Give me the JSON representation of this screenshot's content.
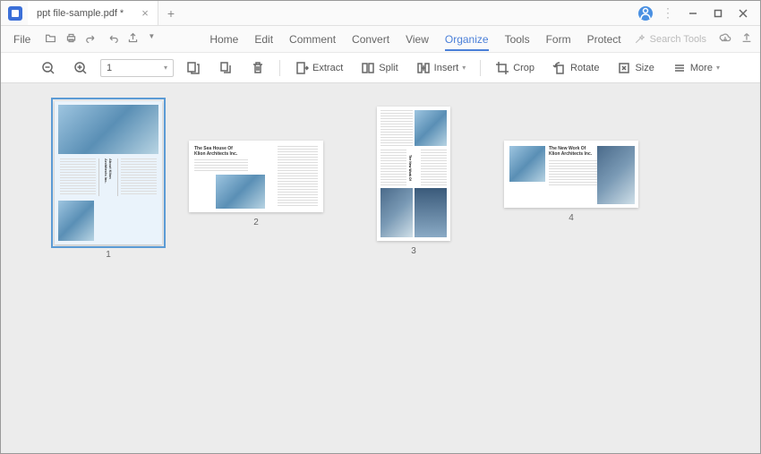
{
  "titlebar": {
    "filename": "ppt file-sample.pdf *"
  },
  "menubar": {
    "file": "File",
    "items": [
      "Home",
      "Edit",
      "Comment",
      "Convert",
      "View",
      "Organize",
      "Tools",
      "Form",
      "Protect"
    ],
    "active_index": 5,
    "search_placeholder": "Search Tools"
  },
  "toolbar": {
    "page_value": "1",
    "extract": "Extract",
    "split": "Split",
    "insert": "Insert",
    "crop": "Crop",
    "rotate": "Rotate",
    "size": "Size",
    "more": "More"
  },
  "pages": {
    "count": 4,
    "selected": 1,
    "labels": [
      "1",
      "2",
      "3",
      "4"
    ],
    "content": {
      "p1_title": "About Klion Architects Inc.",
      "p2_title": "The Sea House Of",
      "p2_sub": "Klion Architects Inc.",
      "p3_title": "The New Work Of",
      "p3_sub": "Klion Architects Inc.",
      "p4_title": "The New Work Of",
      "p4_sub": "Klion Architects Inc."
    }
  }
}
